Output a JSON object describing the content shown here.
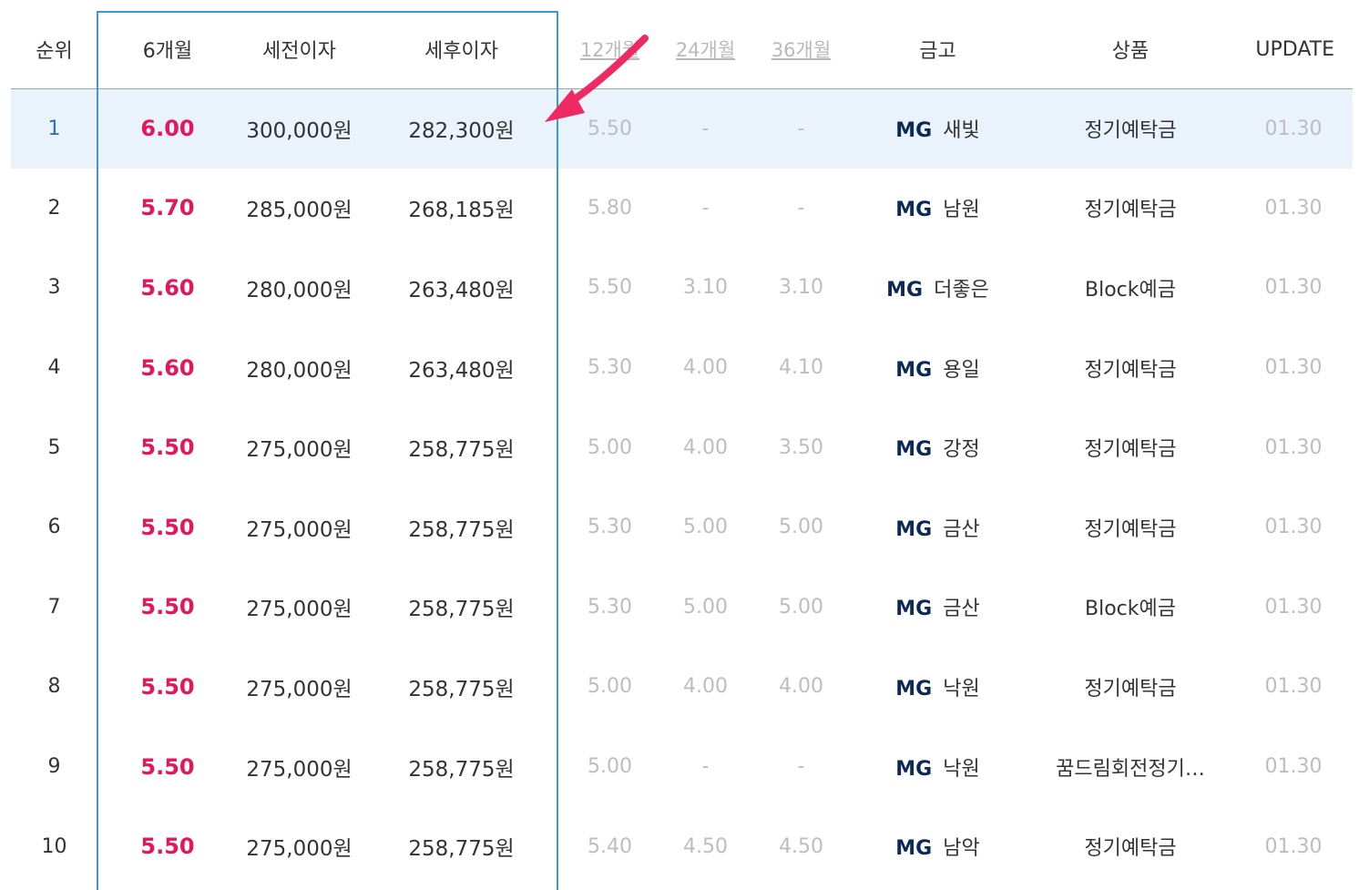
{
  "headers": {
    "rank": "순위",
    "m6": "6개월",
    "pretax": "세전이자",
    "aftertax": "세후이자",
    "m12": "12개월",
    "m24": "24개월",
    "m36": "36개월",
    "bank": "금고",
    "product": "상품",
    "update": "UPDATE"
  },
  "rows": [
    {
      "rank": "1",
      "m6": "6.00",
      "pretax": "300,000원",
      "aftertax": "282,300원",
      "m12": "5.50",
      "m24": "-",
      "m36": "-",
      "mg": "MG",
      "bank": "새빛",
      "product": "정기예탁금",
      "update": "01.30"
    },
    {
      "rank": "2",
      "m6": "5.70",
      "pretax": "285,000원",
      "aftertax": "268,185원",
      "m12": "5.80",
      "m24": "-",
      "m36": "-",
      "mg": "MG",
      "bank": "남원",
      "product": "정기예탁금",
      "update": "01.30"
    },
    {
      "rank": "3",
      "m6": "5.60",
      "pretax": "280,000원",
      "aftertax": "263,480원",
      "m12": "5.50",
      "m24": "3.10",
      "m36": "3.10",
      "mg": "MG",
      "bank": "더좋은",
      "product": "Block예금",
      "update": "01.30"
    },
    {
      "rank": "4",
      "m6": "5.60",
      "pretax": "280,000원",
      "aftertax": "263,480원",
      "m12": "5.30",
      "m24": "4.00",
      "m36": "4.10",
      "mg": "MG",
      "bank": "용일",
      "product": "정기예탁금",
      "update": "01.30"
    },
    {
      "rank": "5",
      "m6": "5.50",
      "pretax": "275,000원",
      "aftertax": "258,775원",
      "m12": "5.00",
      "m24": "4.00",
      "m36": "3.50",
      "mg": "MG",
      "bank": "강정",
      "product": "정기예탁금",
      "update": "01.30"
    },
    {
      "rank": "6",
      "m6": "5.50",
      "pretax": "275,000원",
      "aftertax": "258,775원",
      "m12": "5.30",
      "m24": "5.00",
      "m36": "5.00",
      "mg": "MG",
      "bank": "금산",
      "product": "정기예탁금",
      "update": "01.30"
    },
    {
      "rank": "7",
      "m6": "5.50",
      "pretax": "275,000원",
      "aftertax": "258,775원",
      "m12": "5.30",
      "m24": "5.00",
      "m36": "5.00",
      "mg": "MG",
      "bank": "금산",
      "product": "Block예금",
      "update": "01.30"
    },
    {
      "rank": "8",
      "m6": "5.50",
      "pretax": "275,000원",
      "aftertax": "258,775원",
      "m12": "5.00",
      "m24": "4.00",
      "m36": "4.00",
      "mg": "MG",
      "bank": "낙원",
      "product": "정기예탁금",
      "update": "01.30"
    },
    {
      "rank": "9",
      "m6": "5.50",
      "pretax": "275,000원",
      "aftertax": "258,775원",
      "m12": "5.00",
      "m24": "-",
      "m36": "-",
      "mg": "MG",
      "bank": "낙원",
      "product": "꿈드림회전정기…",
      "update": "01.30"
    },
    {
      "rank": "10",
      "m6": "5.50",
      "pretax": "275,000원",
      "aftertax": "258,775원",
      "m12": "5.40",
      "m24": "4.50",
      "m36": "4.50",
      "mg": "MG",
      "bank": "남악",
      "product": "정기예탁금",
      "update": "01.30"
    }
  ],
  "colors": {
    "highlight_row": "#eaf3fb",
    "rate_accent": "#e2185b",
    "focus_box": "#3c97e0",
    "arrow": "#ee2a62",
    "mg_brand": "#0d2a57"
  },
  "annotations": {
    "focus_box": "blue outline around 6개월 / 세전이자 / 세후이자 columns",
    "arrow_icon": "pink-arrow-icon"
  }
}
